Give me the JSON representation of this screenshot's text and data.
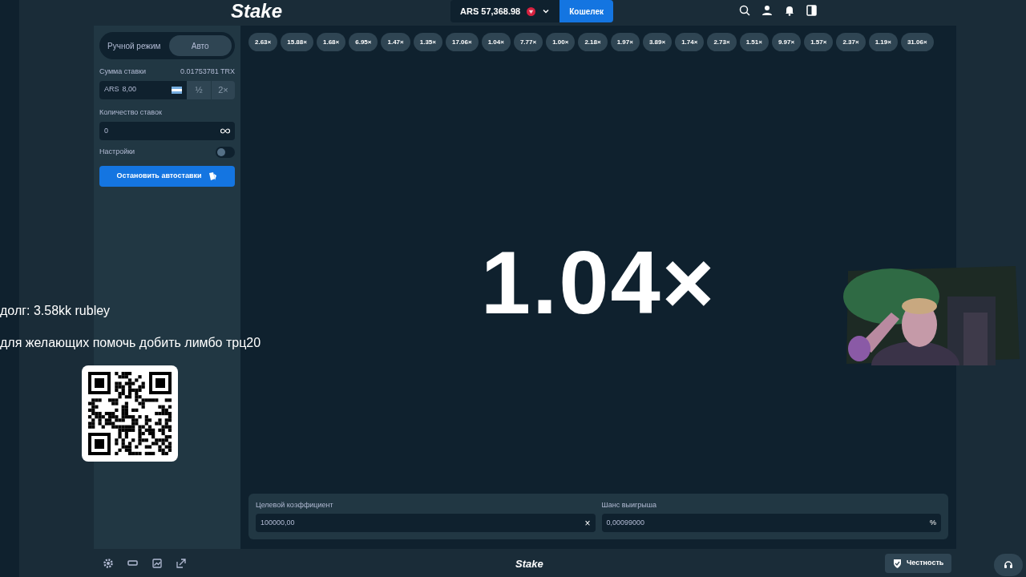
{
  "header": {
    "logo": "Stake",
    "balance": "ARS 57,368.98",
    "wallet_button": "Кошелек"
  },
  "sidebar": {
    "mode_tabs": [
      {
        "label": "Ручной режим",
        "selected": false
      },
      {
        "label": "Авто",
        "selected": true
      }
    ],
    "bet_amount": {
      "label": "Сумма ставки",
      "conversion": "0.01753781 TRX",
      "currency": "ARS",
      "value": "8,00",
      "half": "½",
      "double": "2×",
      "disabled": true
    },
    "bet_count": {
      "label": "Количество ставок",
      "value": "0"
    },
    "settings": {
      "label": "Настройки",
      "on": false
    },
    "action_button": "Остановить автоставки"
  },
  "history": [
    "2.63×",
    "15.88×",
    "1.68×",
    "6.95×",
    "1.47×",
    "1.35×",
    "17.06×",
    "1.04×",
    "7.77×",
    "1.00×",
    "2.18×",
    "1.97×",
    "3.89×",
    "1.74×",
    "2.73×",
    "1.51×",
    "9.97×",
    "1.57×",
    "2.37×",
    "1.19×",
    "31.06×"
  ],
  "result": "1.04×",
  "target": {
    "label": "Целевой коэффициент",
    "value": "100000,00",
    "clear": "×"
  },
  "win_chance": {
    "label": "Шанс выигрыша",
    "value": "0,00099000",
    "suffix": "%"
  },
  "footer": {
    "logo": "Stake",
    "fairness_button": "Честность"
  },
  "overlay": {
    "lines": [
      "долг: 3.58kk rubley",
      "для желающих помочь добить лимбо трц20"
    ]
  }
}
